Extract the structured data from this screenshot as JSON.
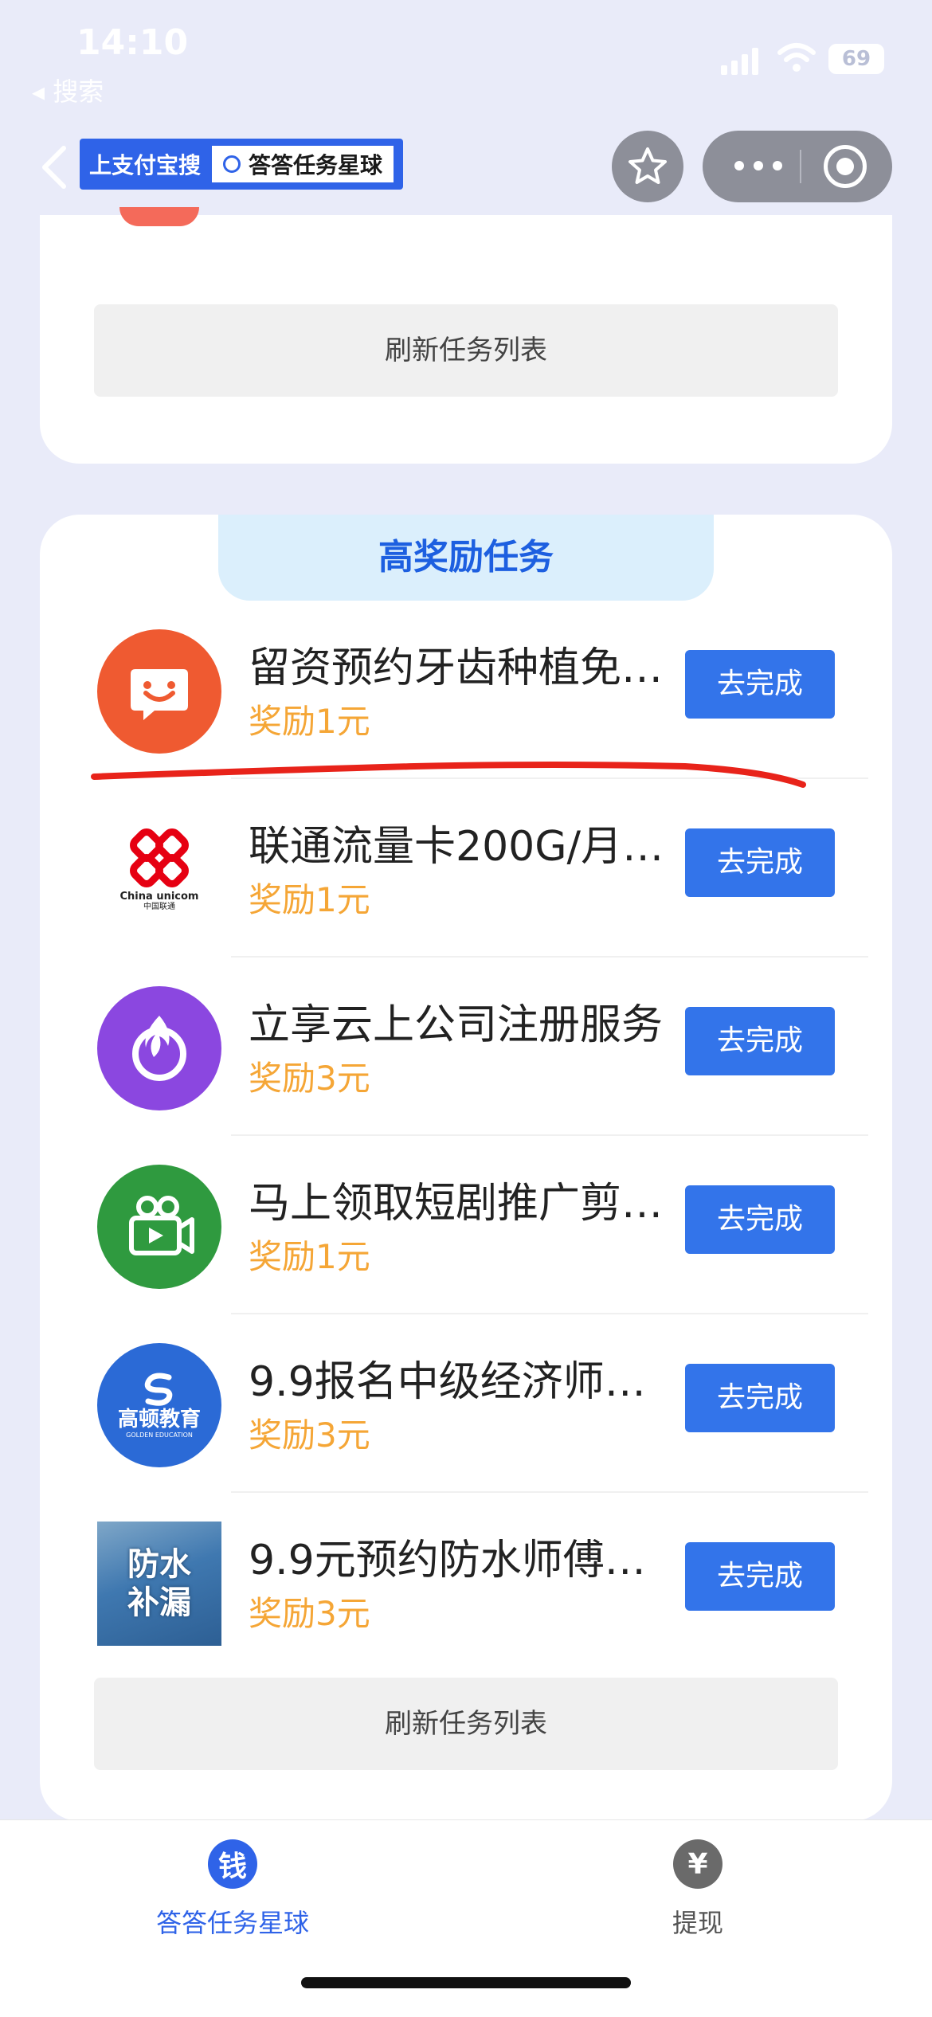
{
  "status_bar": {
    "time": "14:10",
    "back_app": "◂ 搜索",
    "battery": "69"
  },
  "nav": {
    "search_tag_title": "上支付宝搜",
    "search_tag_query": "答答任务星球"
  },
  "card_top": {
    "refresh_label": "刷新任务列表"
  },
  "high_reward": {
    "header": "高奖励任务",
    "tasks": [
      {
        "title": "留资预约牙齿种植免…",
        "reward": "奖励1元",
        "button": "去完成",
        "icon": "smile-logo-icon"
      },
      {
        "title": "联通流量卡200G/月…",
        "reward": "奖励1元",
        "button": "去完成",
        "icon": "china-unicom-logo-icon",
        "logo_text": "China unicom",
        "logo_sub": "中国联通"
      },
      {
        "title": "立享云上公司注册服务",
        "reward": "奖励3元",
        "button": "去完成",
        "icon": "flame-logo-icon"
      },
      {
        "title": "马上领取短剧推广剪…",
        "reward": "奖励1元",
        "button": "去完成",
        "icon": "video-camera-logo-icon"
      },
      {
        "title": "9.9报名中级经济师…",
        "reward": "奖励3元",
        "button": "去完成",
        "icon": "golden-education-logo-icon",
        "logo_text": "高顿教育",
        "logo_sub": "GOLDEN EDUCATION"
      },
      {
        "title": "9.9元预约防水师傅…",
        "reward": "奖励3元",
        "button": "去完成",
        "icon": "waterproof-photo-icon",
        "logo_text": "防水\n补漏"
      }
    ],
    "refresh_label": "刷新任务列表"
  },
  "tabbar": {
    "tabs": [
      {
        "label": "答答任务星球",
        "icon_char": "钱",
        "active": true
      },
      {
        "label": "提现",
        "icon_char": "¥",
        "active": false
      }
    ]
  },
  "colors": {
    "accent": "#3374ea",
    "reward": "#f5a636",
    "header_text": "#1d5fe0",
    "annotation": "#e8231a"
  }
}
